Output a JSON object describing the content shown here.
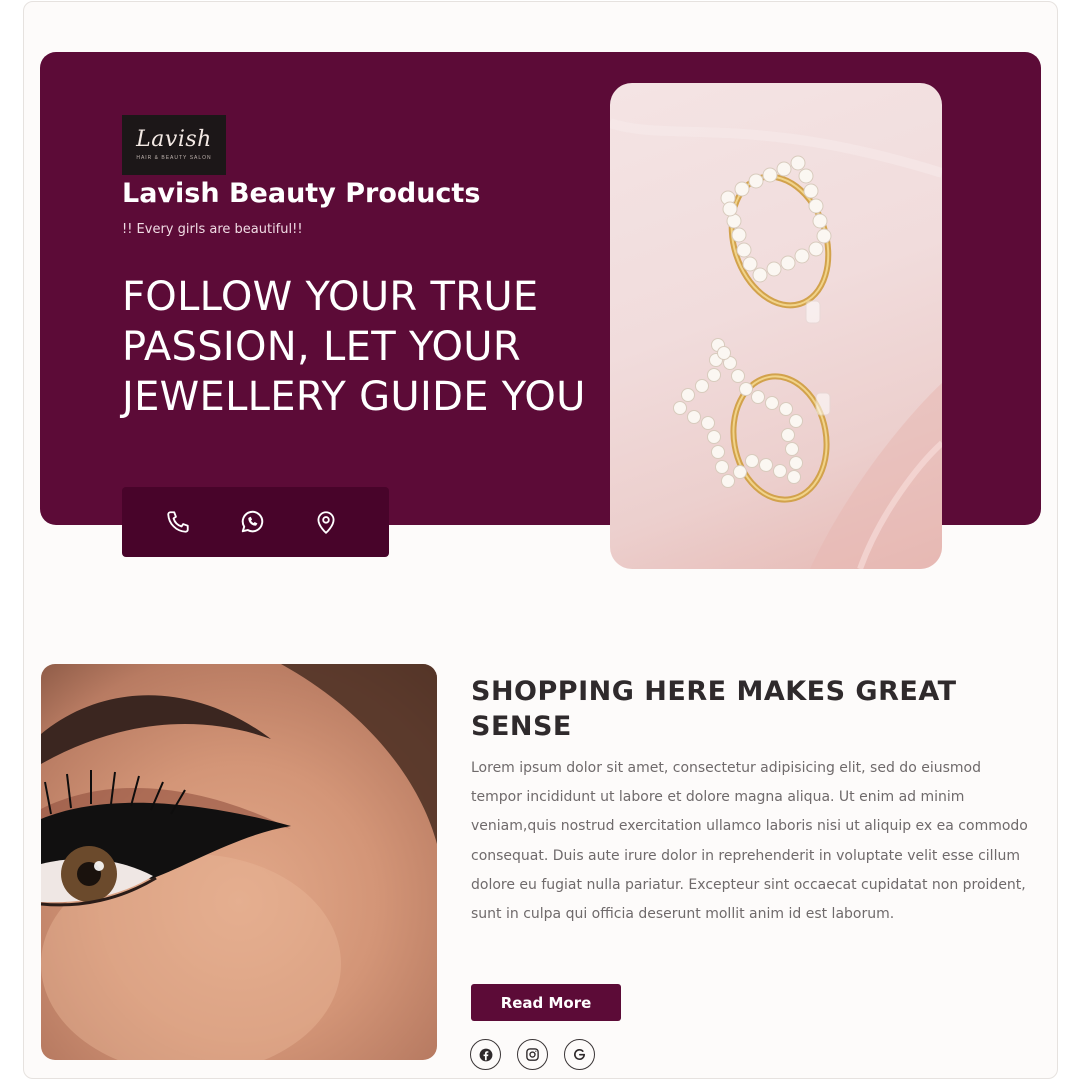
{
  "brand": {
    "logo_script": "Lavish",
    "logo_small": "HAIR & BEAUTY SALON",
    "name": "Lavish Beauty Products",
    "tagline": "!! Every girls are beautiful!!"
  },
  "hero": {
    "headline": "FOLLOW YOUR TRUE PASSION, LET YOUR JEWELLERY GUIDE YOU",
    "image_subject": "pearl earrings",
    "background_color": "#5c0b37",
    "contact_icons": [
      "phone-icon",
      "whatsapp-icon",
      "location-pin-icon"
    ]
  },
  "section": {
    "title": "SHOPPING HERE MAKES GREAT SENSE",
    "body": "Lorem ipsum dolor sit amet, consectetur adipisicing elit, sed do eiusmod tempor incididunt ut labore et dolore magna aliqua. Ut enim ad minim veniam,quis nostrud exercitation ullamco laboris nisi ut aliquip ex ea commodo consequat. Duis aute irure dolor in reprehenderit in voluptate velit esse cillum dolore eu fugiat nulla pariatur. Excepteur sint occaecat cupidatat non proident, sunt in culpa qui officia deserunt mollit anim id est laborum.",
    "button_label": "Read More",
    "image_subject": "eye with winged eyeliner",
    "socials": [
      "facebook-icon",
      "instagram-icon",
      "google-icon"
    ]
  },
  "colors": {
    "accent": "#5c0b37",
    "accent_dark": "#48042a",
    "page_bg": "#fdfbfa"
  }
}
